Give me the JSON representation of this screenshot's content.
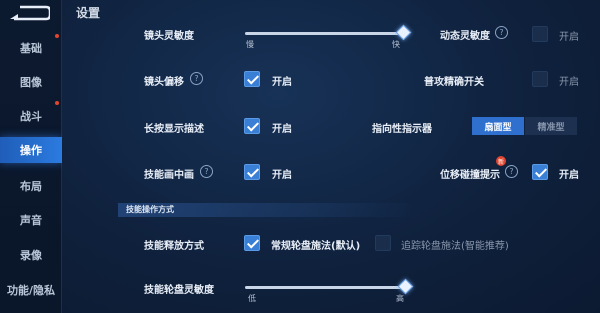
{
  "header": {
    "title": "设置"
  },
  "sidebar": {
    "items": [
      {
        "label": "基础"
      },
      {
        "label": "图像"
      },
      {
        "label": "战斗"
      },
      {
        "label": "操作"
      },
      {
        "label": "布局"
      },
      {
        "label": "声音"
      },
      {
        "label": "录像"
      },
      {
        "label": "功能/隐私"
      }
    ],
    "active": "操作"
  },
  "settings": {
    "camera_sensitivity": {
      "label": "镜头灵敏度",
      "low": "慢",
      "high": "快",
      "value": 0.97
    },
    "dynamic_sensitivity": {
      "label": "动态灵敏度",
      "state": "开启",
      "checked": false
    },
    "camera_offset": {
      "label": "镜头偏移",
      "state": "开启",
      "checked": true
    },
    "attack_targeting": {
      "label": "普攻精确开关",
      "state": "开启",
      "checked": false
    },
    "long_press_desc": {
      "label": "长按显示描述",
      "state": "开启",
      "checked": true
    },
    "direction_indicator": {
      "label": "指向性指示器",
      "options": [
        "扇面型",
        "精准型"
      ],
      "selected": "扇面型"
    },
    "skill_pip": {
      "label": "技能画中画",
      "state": "开启",
      "checked": true
    },
    "displacement_hint": {
      "label": "位移碰撞提示",
      "state": "开启",
      "checked": true,
      "badge": "新"
    }
  },
  "skill_section": {
    "title": "技能操作方式",
    "release_mode": {
      "label": "技能释放方式",
      "option1": "常规轮盘施法(默认)",
      "option1_checked": true,
      "option2": "追踪轮盘施法(智能推荐)",
      "option2_checked": false
    },
    "wheel_sensitivity": {
      "label": "技能轮盘灵敏度",
      "low": "低",
      "high": "高",
      "value": 0.98
    }
  },
  "colors": {
    "accent": "#2f6fce",
    "background": "#0d1b31"
  }
}
